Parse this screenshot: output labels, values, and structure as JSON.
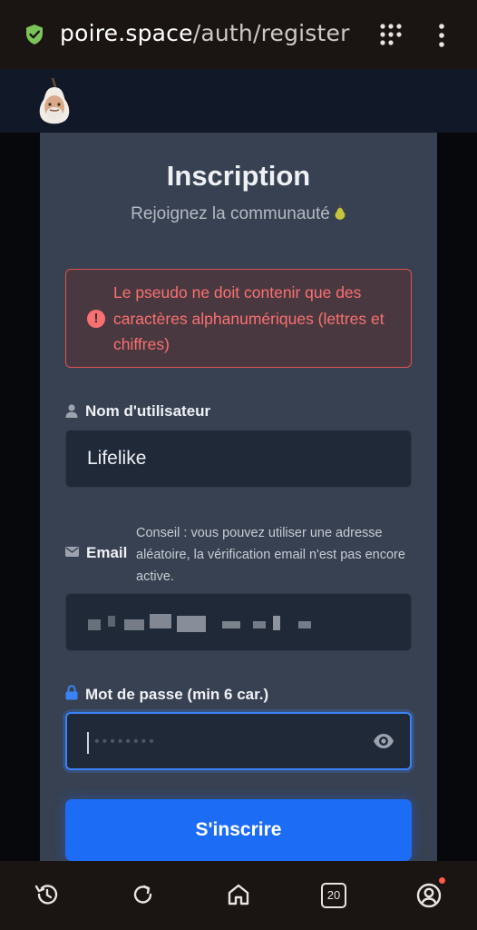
{
  "browser": {
    "url_host": "poire.space",
    "url_path": "/auth/register",
    "icons": [
      "secure-shield-icon",
      "apps-grid-icon",
      "more-vert-icon"
    ],
    "bottom_nav": {
      "icons": [
        "history-icon",
        "reload-icon",
        "home-icon",
        "tabs-icon",
        "account-icon"
      ],
      "tab_count": "20"
    }
  },
  "form": {
    "title": "Inscription",
    "subtitle": "Rejoignez la communauté",
    "error": "Le pseudo ne doit contenir que des caractères alphanumériques (lettres et chiffres)",
    "username": {
      "label": "Nom d'utilisateur",
      "value": "Lifelike"
    },
    "email": {
      "label": "Email",
      "hint": "Conseil : vous pouvez utiliser une adresse aléatoire, la vérification email n'est pas encore active."
    },
    "password": {
      "label": "Mot de passe (min 6 car.)",
      "masked_value": "••••••••"
    },
    "submit_label": "S'inscrire"
  },
  "colors": {
    "accent": "#1d6cf5",
    "error": "#f87171",
    "card": "#374151",
    "input": "#1f2937"
  }
}
